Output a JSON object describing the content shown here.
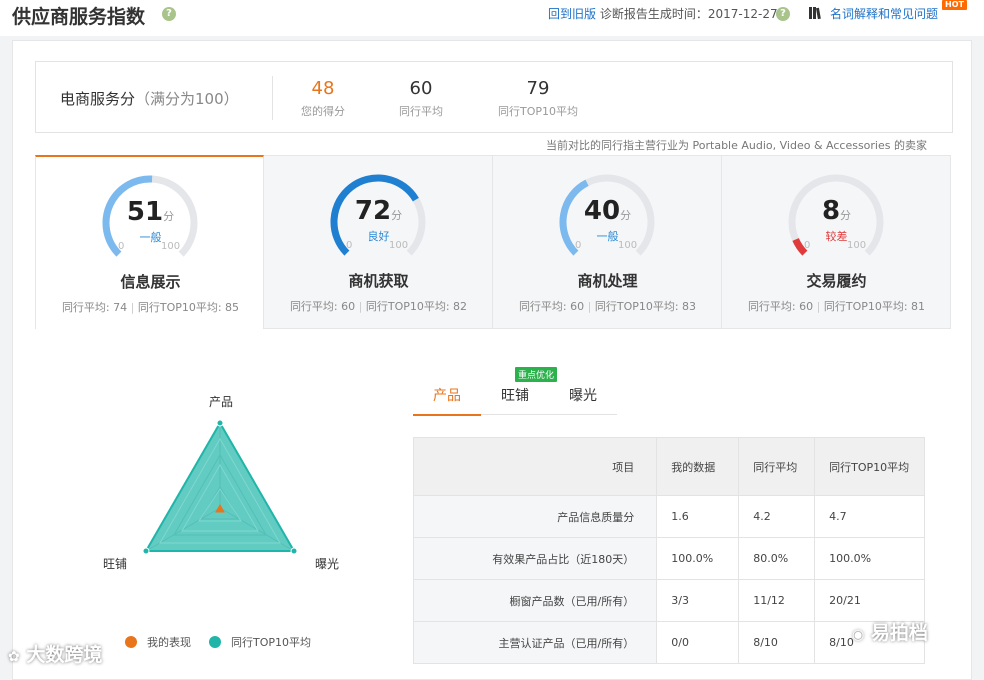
{
  "header": {
    "title": "供应商服务指数",
    "old_version_link": "回到旧版",
    "report_time_label": "诊断报告生成时间：",
    "report_time": "2017-12-27",
    "glossary_link": "名词解释和常见问题",
    "hot_badge": "HOT"
  },
  "summary": {
    "label": "电商服务分",
    "label_note": "（满分为100）",
    "my_score": "48",
    "my_score_label": "您的得分",
    "peer_avg": "60",
    "peer_avg_label": "同行平均",
    "top10_avg": "79",
    "top10_avg_label": "同行TOP10平均"
  },
  "compare_note": "当前对比的同行指主营行业为 Portable Audio, Video & Accessories 的卖家",
  "metrics": [
    {
      "name": "信息展示",
      "score": "51",
      "score_value": 51,
      "unit": "分",
      "level": "一般",
      "level_color": "#2b8ad6",
      "arc_color": "#7cb9ee",
      "min": "0",
      "max": "100",
      "avg": "同行平均: 74",
      "top10": "同行TOP10平均: 85"
    },
    {
      "name": "商机获取",
      "score": "72",
      "score_value": 72,
      "unit": "分",
      "level": "良好",
      "level_color": "#2b8ad6",
      "arc_color": "#1f7fd1",
      "min": "0",
      "max": "100",
      "avg": "同行平均: 60",
      "top10": "同行TOP10平均: 82"
    },
    {
      "name": "商机处理",
      "score": "40",
      "score_value": 40,
      "unit": "分",
      "level": "一般",
      "level_color": "#2b8ad6",
      "arc_color": "#7cb9ee",
      "min": "0",
      "max": "100",
      "avg": "同行平均: 60",
      "top10": "同行TOP10平均: 83"
    },
    {
      "name": "交易履约",
      "score": "8",
      "score_value": 8,
      "unit": "分",
      "level": "较差",
      "level_color": "#e03a3a",
      "arc_color": "#e03a3a",
      "min": "0",
      "max": "100",
      "avg": "同行平均: 60",
      "top10": "同行TOP10平均: 81"
    }
  ],
  "radar": {
    "axes": [
      "产品",
      "曝光",
      "旺铺"
    ],
    "legend_mine": "我的表现",
    "legend_top10": "同行TOP10平均",
    "mine_color": "#e8741c",
    "top10_color": "#1fb5a8"
  },
  "tabs": [
    {
      "label": "产品",
      "active": true
    },
    {
      "label": "旺铺",
      "active": false
    },
    {
      "label": "曝光",
      "active": false
    }
  ],
  "tab_badge": "重点优化",
  "table": {
    "headers": [
      "项目",
      "我的数据",
      "同行平均",
      "同行TOP10平均"
    ],
    "rows": [
      [
        "产品信息质量分",
        "1.6",
        "4.2",
        "4.7"
      ],
      [
        "有效果产品占比（近180天）",
        "100.0%",
        "80.0%",
        "100.0%"
      ],
      [
        "橱窗产品数（已用/所有）",
        "3/3",
        "11/12",
        "20/21"
      ],
      [
        "主营认证产品（已用/所有）",
        "0/0",
        "8/10",
        "8/10"
      ]
    ]
  },
  "watermarks": [
    "大数跨境",
    "易拍档"
  ]
}
